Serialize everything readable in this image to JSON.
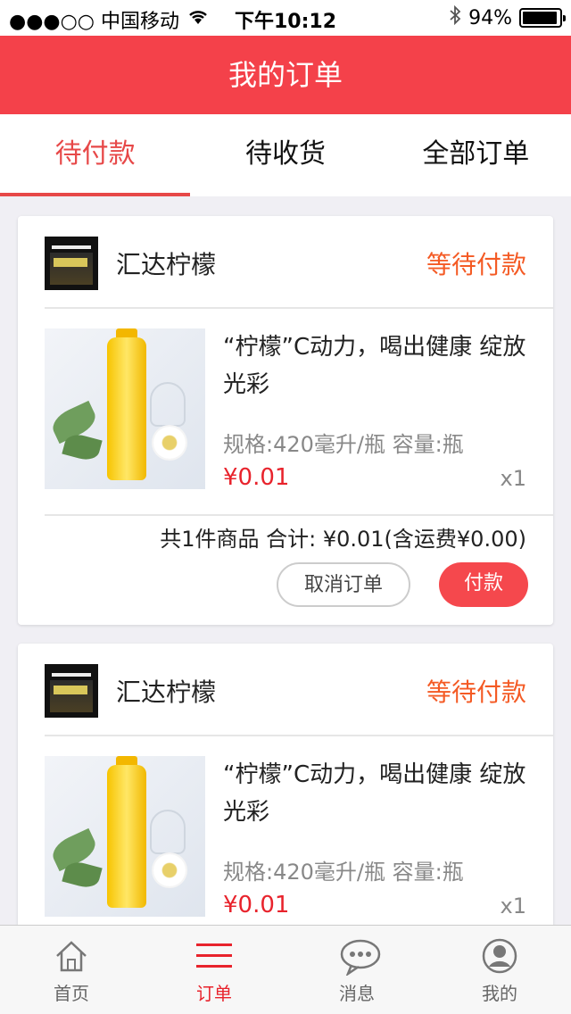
{
  "status_bar": {
    "carrier": "●●●○○ 中国移动",
    "time": "下午10:12",
    "battery": "94%"
  },
  "header": {
    "title": "我的订单"
  },
  "tabs": [
    {
      "label": "待付款"
    },
    {
      "label": "待收货"
    },
    {
      "label": "全部订单"
    }
  ],
  "orders": [
    {
      "store_name": "汇达柠檬",
      "status": "等待付款",
      "product_title": "“柠檬”C动力，喝出健康 绽放光彩",
      "spec": "规格:420毫升/瓶    容量:瓶",
      "price": "¥0.01",
      "quantity": "x1",
      "summary": "共1件商品 合计: ¥0.01(含运费¥0.00)",
      "cancel_label": "取消订单",
      "pay_label": "付款"
    },
    {
      "store_name": "汇达柠檬",
      "status": "等待付款",
      "product_title": "“柠檬”C动力，喝出健康 绽放光彩",
      "spec": "规格:420毫升/瓶    容量:瓶",
      "price": "¥0.01",
      "quantity": "x1"
    }
  ],
  "tabbar": [
    {
      "label": "首页",
      "icon": "home-icon"
    },
    {
      "label": "订单",
      "icon": "menu-icon"
    },
    {
      "label": "消息",
      "icon": "chat-icon"
    },
    {
      "label": "我的",
      "icon": "user-icon"
    }
  ],
  "colors": {
    "brand_red": "#f4414a",
    "status_orange": "#f45a24",
    "price_red": "#e8232c"
  }
}
